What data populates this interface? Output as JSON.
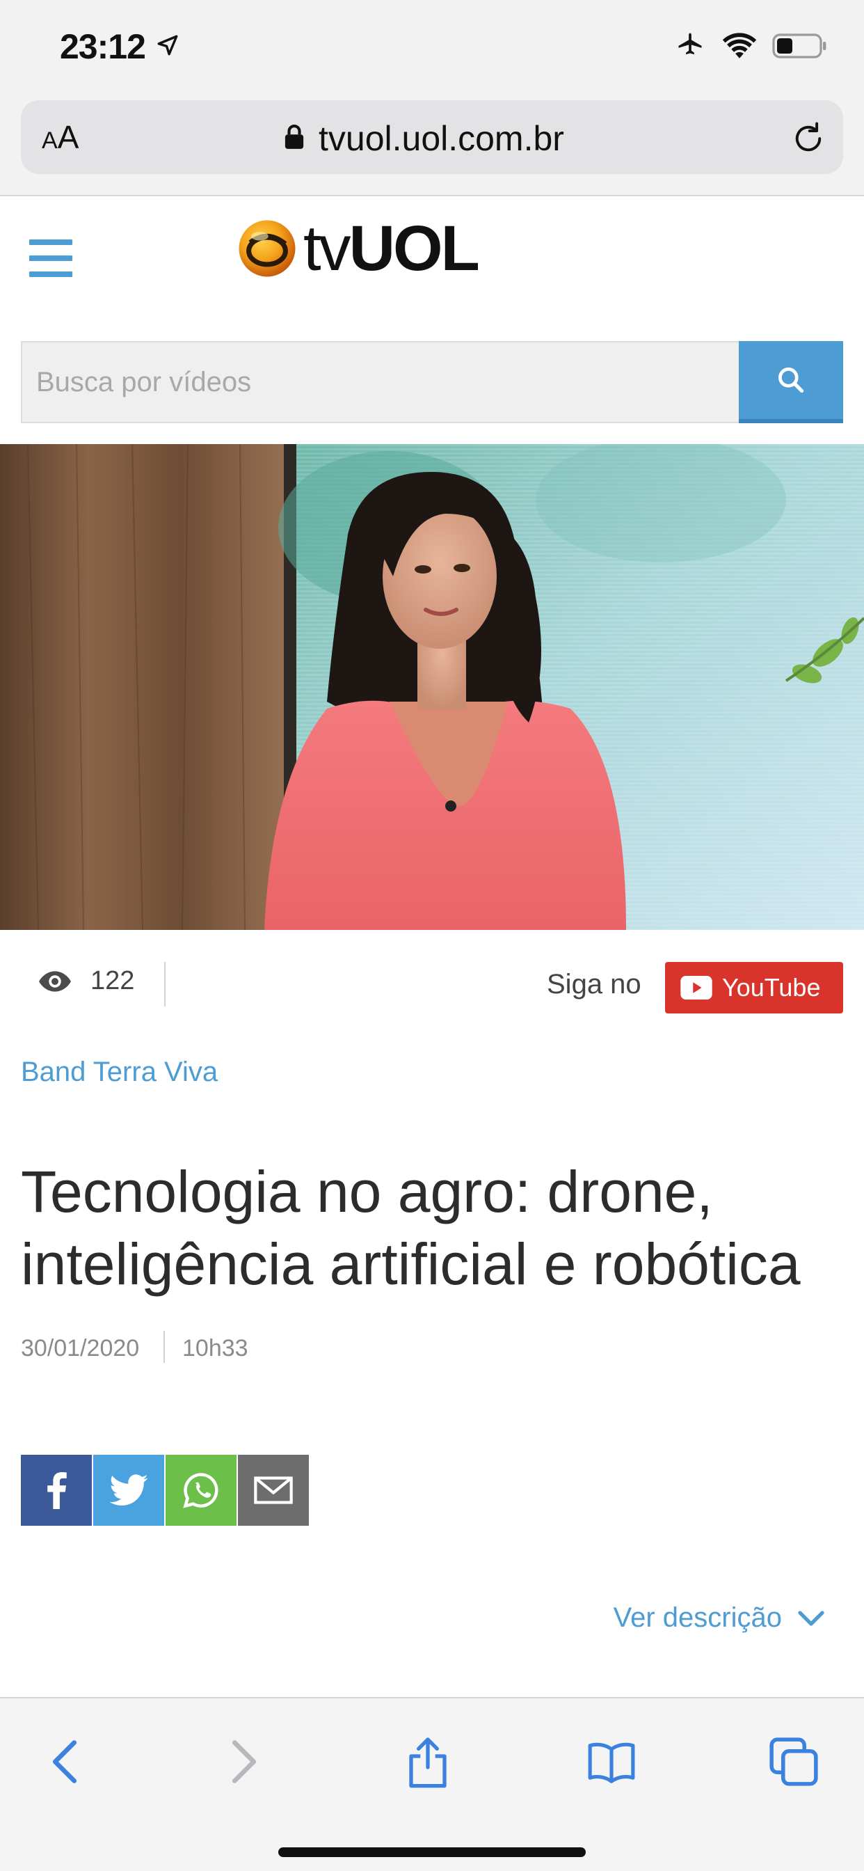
{
  "status_bar": {
    "time": "23:12"
  },
  "browser": {
    "text_size_small": "A",
    "text_size_large": "A",
    "url": "tvuol.uol.com.br"
  },
  "site": {
    "logo_tv": "tv",
    "logo_uol": "UOL",
    "search": {
      "placeholder": "Busca por vídeos"
    }
  },
  "video_meta": {
    "views": "122",
    "follow_label": "Siga no",
    "youtube_label": "YouTube"
  },
  "article": {
    "channel": "Band Terra Viva",
    "title": "Tecnologia no agro: drone, inteligência artificial e robótica",
    "date": "30/01/2020",
    "time": "10h33",
    "description_toggle": "Ver descrição"
  },
  "colors": {
    "accent": "#4d9cd4",
    "youtube": "#d9342b",
    "facebook": "#3b5998",
    "twitter": "#4aa3df",
    "whatsapp": "#6cc04a",
    "email": "#6d6d6d"
  },
  "icons": {
    "status": [
      "location-arrow-icon",
      "airplane-icon",
      "wifi-icon",
      "battery-icon"
    ],
    "share": [
      "facebook-icon",
      "twitter-icon",
      "whatsapp-icon",
      "email-icon"
    ],
    "toolbar": [
      "back-icon",
      "forward-icon",
      "share-icon",
      "bookmarks-icon",
      "tabs-icon"
    ]
  }
}
